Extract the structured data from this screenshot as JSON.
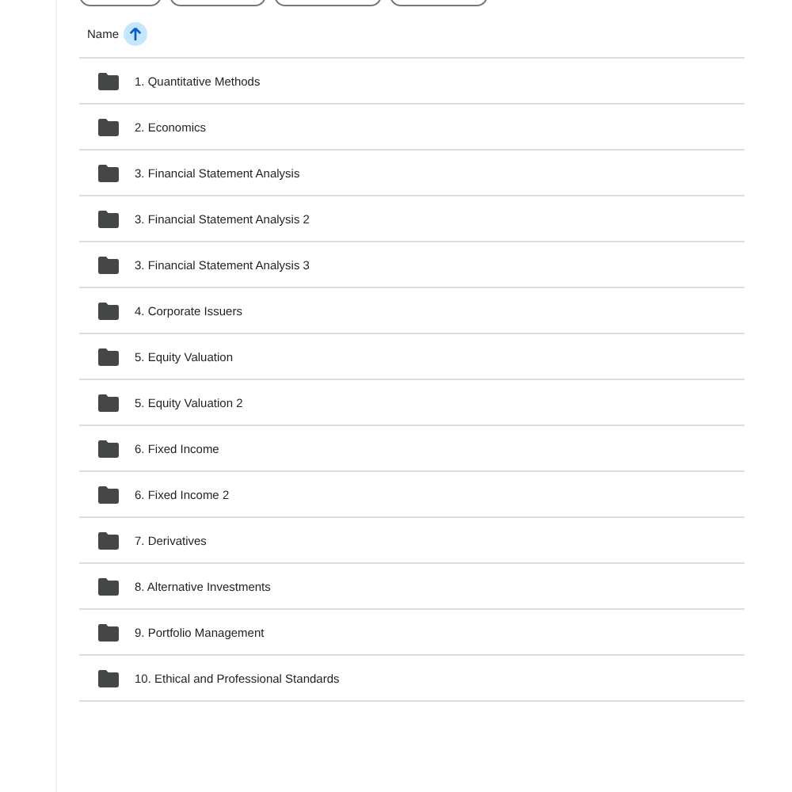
{
  "filter_chips": [
    {
      "kind": "chip"
    },
    {
      "kind": "chip"
    },
    {
      "kind": "chip"
    },
    {
      "kind": "chip"
    }
  ],
  "table": {
    "sort_column": "Name",
    "sort_ascending": true,
    "rows": [
      {
        "kind": "folder",
        "name": "1. Quantitative Methods"
      },
      {
        "kind": "folder",
        "name": "2. Economics"
      },
      {
        "kind": "folder",
        "name": "3. Financial Statement Analysis"
      },
      {
        "kind": "folder",
        "name": "3. Financial Statement Analysis 2"
      },
      {
        "kind": "folder",
        "name": "3. Financial Statement Analysis 3"
      },
      {
        "kind": "folder",
        "name": "4. Corporate Issuers"
      },
      {
        "kind": "folder",
        "name": "5. Equity Valuation"
      },
      {
        "kind": "folder",
        "name": "5. Equity Valuation 2"
      },
      {
        "kind": "folder",
        "name": "6. Fixed Income"
      },
      {
        "kind": "folder",
        "name": "6. Fixed Income 2"
      },
      {
        "kind": "folder",
        "name": "7. Derivatives"
      },
      {
        "kind": "folder",
        "name": "8. Alternative Investments"
      },
      {
        "kind": "folder",
        "name": "9. Portfolio Management"
      },
      {
        "kind": "folder",
        "name": "10. Ethical and Professional Standards"
      }
    ]
  }
}
